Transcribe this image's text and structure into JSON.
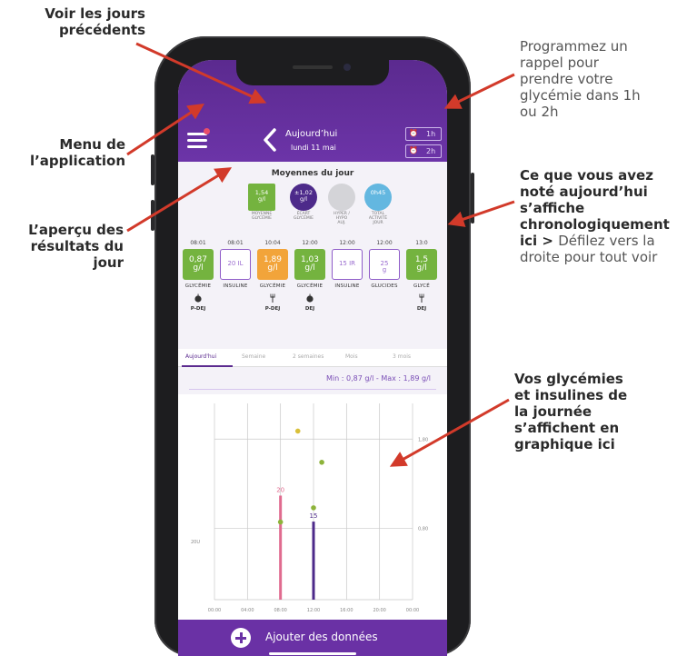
{
  "callouts": {
    "previous_days": "Voir les jours\nprécédents",
    "menu": "Menu de\nl’application",
    "overview": "L’aperçu des\nrésultats du\njour",
    "reminder": "Programmez un\nrappel pour\nprendre votre\nglycémie dans 1h\nou 2h",
    "chronological_bold": "Ce que vous avez\nnoté aujourd’hui\ns’affiche\nchronologiquement\nici > ",
    "chronological_normal": "Défilez vers la\ndroite pour tout voir",
    "chart_note": "Vos glycémies\net insulines de\nla journée\ns’affichent en\ngraphique ici"
  },
  "header": {
    "title": "Aujourd’hui",
    "date": "lundi 11 mai",
    "reminder_1h": "1h",
    "reminder_2h": "2h"
  },
  "averages": {
    "title": "Moyennes du jour",
    "items": [
      {
        "value": "1,54\ng/l",
        "label": "MOYENNE\nGLYCÉMIE",
        "color": "#74b33f",
        "shape": "square"
      },
      {
        "value": "±1,02\ng/l",
        "label": "ÉCART\nGLYCÉMIE",
        "color": "#4d2a8a",
        "shape": "circle"
      },
      {
        "value": "",
        "label": "HYPER /\nHYPO\nAUJ.",
        "color": "#d4d4d8",
        "shape": "circle"
      },
      {
        "value": "0h45",
        "label": "TOTAL\nACTIVITÉ\nJOUR",
        "color": "#63b7e0",
        "shape": "circle"
      }
    ]
  },
  "timeline": [
    {
      "time": "08:01",
      "value": "0,87\ng/l",
      "style": "filled",
      "color": "#74b33f",
      "category": "GLYCÉMIE",
      "meal": "P-DEJ",
      "meal_icon": "apple-icon"
    },
    {
      "time": "08:01",
      "value": "20 IL",
      "style": "outline",
      "color": "#8e5bc8",
      "category": "INSULINE",
      "meal": "",
      "meal_icon": ""
    },
    {
      "time": "10:04",
      "value": "1,89\ng/l",
      "style": "filled",
      "color": "#f2a43a",
      "category": "GLYCÉMIE",
      "meal": "P-DEJ",
      "meal_icon": "fork-icon"
    },
    {
      "time": "12:00",
      "value": "1,03\ng/l",
      "style": "filled",
      "color": "#74b33f",
      "category": "GLYCÉMIE",
      "meal": "DEJ",
      "meal_icon": "apple-icon"
    },
    {
      "time": "12:00",
      "value": "15 IR",
      "style": "outline",
      "color": "#8e5bc8",
      "category": "INSULINE",
      "meal": "",
      "meal_icon": ""
    },
    {
      "time": "12:00",
      "value": "25\ng",
      "style": "outline",
      "color": "#8e5bc8",
      "category": "GLUCIDES",
      "meal": "",
      "meal_icon": ""
    },
    {
      "time": "13:0",
      "value": "1,5\ng/l",
      "style": "filled",
      "color": "#74b33f",
      "category": "GLYCÉ",
      "meal": "DEJ",
      "meal_icon": "fork-icon"
    }
  ],
  "tabs": [
    "Aujourd'hui",
    "Semaine",
    "2 semaines",
    "Mois",
    "3 mois"
  ],
  "minmax": "Min : 0,87 g/l - Max : 1,89 g/l",
  "add_button": "Ajouter des données",
  "colors": {
    "purple": "#5b2a8f",
    "green": "#74b33f",
    "orange": "#f2a43a",
    "pink": "#e06b8f",
    "arrow_red": "#d23a2a",
    "dot_green": "#8db33a",
    "dot_yellow": "#d9c03a"
  },
  "chart_data": {
    "type": "scatter",
    "x_ticks": [
      "00:00",
      "04:00",
      "08:00",
      "12:00",
      "16:00",
      "20:00",
      "00:00"
    ],
    "y_tick_labels": [
      "1,80",
      "0,80"
    ],
    "y_tick_values": [
      1.8,
      0.8
    ],
    "left_label": "20U",
    "x_hours_range": [
      0,
      24
    ],
    "y_glycemia_range": [
      0.0,
      2.2
    ],
    "glycemia_points": [
      {
        "hour": 8.0,
        "value": 0.87,
        "color": "#8db33a"
      },
      {
        "hour": 10.1,
        "value": 1.89,
        "color": "#d9c03a"
      },
      {
        "hour": 12.0,
        "value": 1.03,
        "color": "#8db33a"
      },
      {
        "hour": 13.0,
        "value": 1.54,
        "color": "#8db33a"
      }
    ],
    "insulin_bars": [
      {
        "hour": 8.0,
        "units": 20,
        "label": "20",
        "color": "#e06b8f"
      },
      {
        "hour": 12.0,
        "units": 15,
        "label": "15",
        "color": "#4d2a8a"
      }
    ],
    "insulin_max": 22
  }
}
